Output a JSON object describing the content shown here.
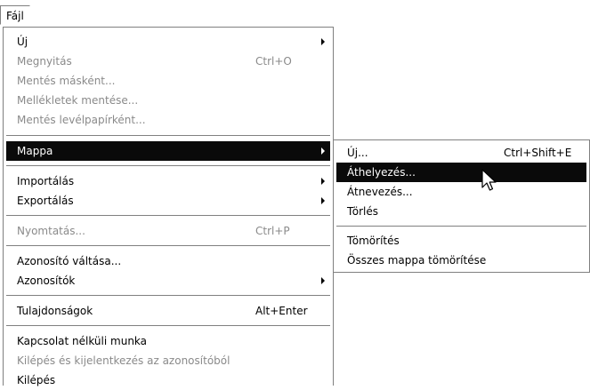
{
  "menubar": {
    "file_label": "Fájl"
  },
  "main_menu": {
    "items": [
      {
        "label": "Új",
        "shortcut": ""
      },
      {
        "label": "Megnyitás",
        "shortcut": "Ctrl+O"
      },
      {
        "label": "Mentés másként...",
        "shortcut": ""
      },
      {
        "label": "Mellékletek mentése...",
        "shortcut": ""
      },
      {
        "label": "Mentés levélpapírként...",
        "shortcut": ""
      },
      {
        "label": "Mappa",
        "shortcut": ""
      },
      {
        "label": "Importálás",
        "shortcut": ""
      },
      {
        "label": "Exportálás",
        "shortcut": ""
      },
      {
        "label": "Nyomtatás...",
        "shortcut": "Ctrl+P"
      },
      {
        "label": "Azonosító váltása...",
        "shortcut": ""
      },
      {
        "label": "Azonosítók",
        "shortcut": ""
      },
      {
        "label": "Tulajdonságok",
        "shortcut": "Alt+Enter"
      },
      {
        "label": "Kapcsolat nélküli munka",
        "shortcut": ""
      },
      {
        "label": "Kilépés és kijelentkezés az azonosítóból",
        "shortcut": ""
      },
      {
        "label": "Kilépés",
        "shortcut": ""
      }
    ]
  },
  "submenu": {
    "items": [
      {
        "label": "Új...",
        "shortcut": "Ctrl+Shift+E"
      },
      {
        "label": "Áthelyezés...",
        "shortcut": ""
      },
      {
        "label": "Átnevezés...",
        "shortcut": ""
      },
      {
        "label": "Törlés",
        "shortcut": ""
      },
      {
        "label": "Tömörítés",
        "shortcut": ""
      },
      {
        "label": "Összes mappa tömörítése",
        "shortcut": ""
      }
    ]
  }
}
